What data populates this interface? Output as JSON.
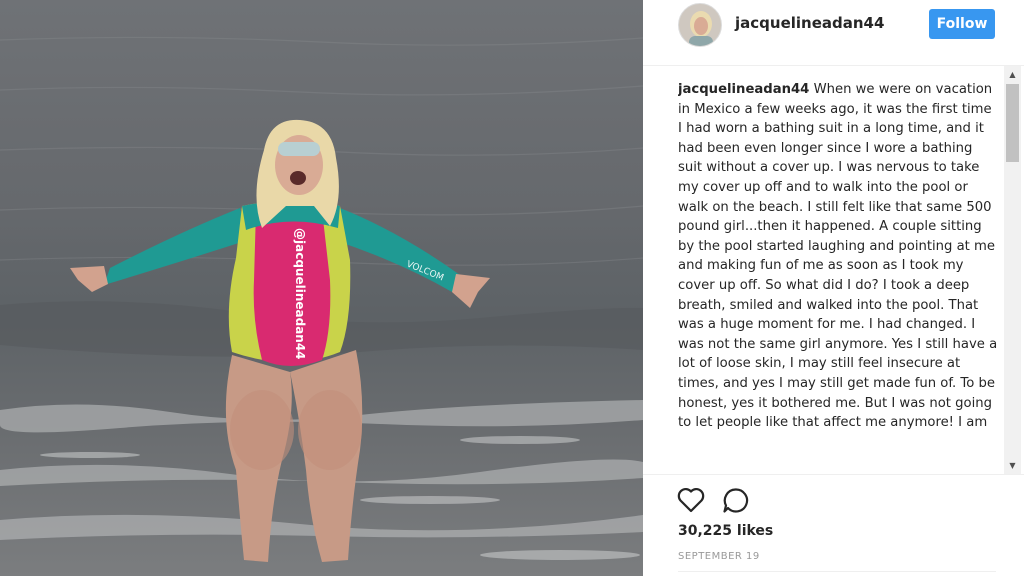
{
  "post": {
    "username": "jacquelineadan44",
    "follow_label": "Follow",
    "caption_user": "jacquelineadan44",
    "caption_text": "When we were on vacation in Mexico a few weeks ago, it was the first time I had worn a bathing suit in a long time, and it had been even longer since I wore a bathing suit without a cover up. I was nervous to take my cover up off and to walk into the pool or walk on the beach. I still felt like that same 500 pound girl...then it happened. A couple sitting by the pool started laughing and pointing at me and making fun of me as soon as I took my cover up off. So what did I do? I took a deep breath, smiled and walked into the pool. That was a huge moment for me. I had changed. I was not the same girl anymore. Yes I still have a lot of loose skin, I may still feel insecure at times, and yes I may still get made fun of. To be honest, yes it bothered me. But I was not going to let people like that affect me anymore! I am",
    "likes": "30,225 likes",
    "date": "SEPTEMBER 19"
  },
  "photo": {
    "swimsuit_text": "@jacquelineadan44",
    "sleeve_text": "VOLCOM"
  },
  "icons": {
    "heart": "heart-icon",
    "comment": "comment-icon",
    "scroll_up": "scroll-up-icon",
    "scroll_down": "scroll-down-icon"
  },
  "colors": {
    "follow_button": "#3897f0",
    "swimsuit_teal": "#1f9a93",
    "swimsuit_pink": "#d92a70",
    "swimsuit_yellow": "#c9d34a"
  }
}
